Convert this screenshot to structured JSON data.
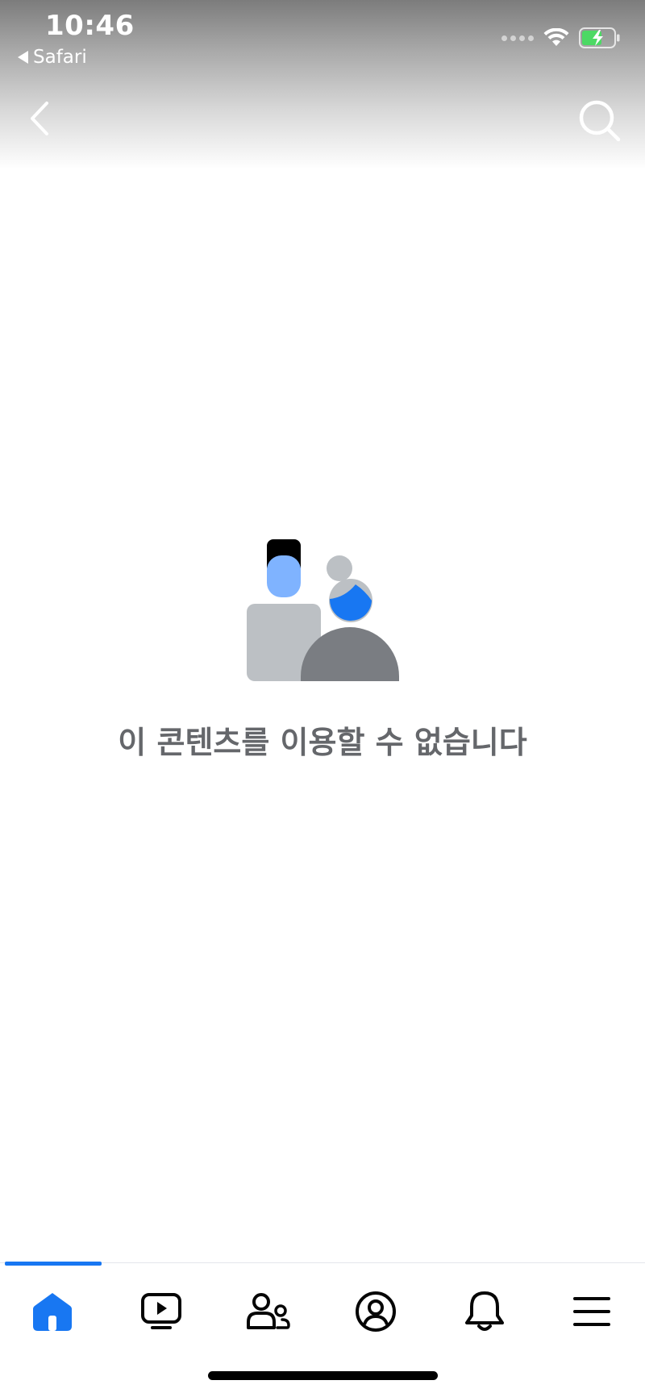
{
  "status_bar": {
    "time": "10:46",
    "back_app": "Safari",
    "battery_color": "#4cd964"
  },
  "header": {
    "back_icon": "chevron-left-icon",
    "search_icon": "search-icon"
  },
  "content": {
    "message": "이 콘텐츠를 이용할 수 없습니다",
    "illustration": "unavailable-content-illustration"
  },
  "tabbar": {
    "active_color": "#1877f2",
    "tabs": [
      {
        "name": "home",
        "icon": "home-icon",
        "active": true
      },
      {
        "name": "video",
        "icon": "video-icon",
        "active": false
      },
      {
        "name": "friends",
        "icon": "friends-icon",
        "active": false
      },
      {
        "name": "profile",
        "icon": "profile-icon",
        "active": false
      },
      {
        "name": "notifications",
        "icon": "bell-icon",
        "active": false
      },
      {
        "name": "menu",
        "icon": "menu-icon",
        "active": false
      }
    ]
  }
}
